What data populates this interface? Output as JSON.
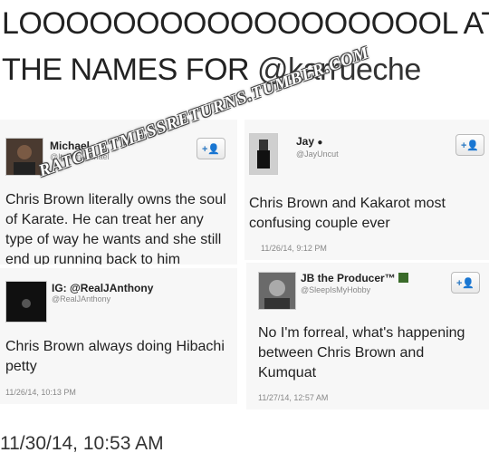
{
  "headline": {
    "line1": "LOOOOOOOOOOOOOOOOOOL AT",
    "line2_text": "THE NAMES FOR ",
    "line2_mention": "@karrueche"
  },
  "watermark": "RATCHETMESSRETURNS.TUMBLR.COM",
  "tweets": [
    {
      "name": "Michael",
      "handle": "@ItsHimMichael",
      "text_lines": [
        "Chris Brown literally owns the soul",
        "of Karate. He can treat her any",
        "type of way he wants and she still",
        "end up running back to him"
      ],
      "timestamp": "",
      "follow_icon": "follow-user-icon"
    },
    {
      "name": "Jay",
      "name_suffix": "",
      "handle": "@JayUncut",
      "text_lines": [
        "Chris Brown and Kakarot most",
        "confusing couple ever"
      ],
      "timestamp": "11/26/14, 9:12 PM",
      "follow_icon": "follow-user-icon"
    },
    {
      "name": "IG: @RealJAnthony",
      "handle": "@RealJAnthony",
      "text_lines": [
        "Chris Brown always doing Hibachi",
        "petty"
      ],
      "timestamp": "11/26/14, 10:13 PM"
    },
    {
      "name": "JB the Producer™",
      "handle": "@SleepIsMyHobby",
      "text_lines": [
        "No I'm forreal, what's happening",
        "between Chris Brown and",
        "Kumquat"
      ],
      "timestamp": "11/27/14, 12:57 AM",
      "follow_icon": "follow-user-icon"
    }
  ],
  "follow_symbol": "+👤",
  "footer_timestamp": "11/30/14, 10:53 AM"
}
